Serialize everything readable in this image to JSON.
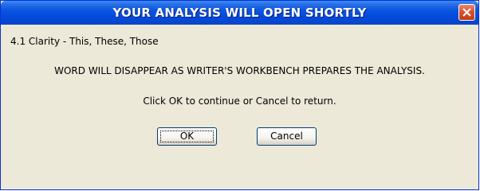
{
  "dialog": {
    "title": "YOUR ANALYSIS WILL OPEN SHORTLY",
    "close_icon": "close-icon",
    "subtitle": "4.1 Clarity - This, These, Those",
    "message": "WORD WILL DISAPPEAR AS WRITER'S WORKBENCH PREPARES THE ANALYSIS.",
    "instruction": "Click OK to continue or Cancel to return.",
    "ok_label": "OK",
    "cancel_label": "Cancel"
  },
  "colors": {
    "titlebar": "#0a55e0",
    "close_button": "#d7542f",
    "body": "#ece9d8",
    "border": "#0831d9"
  }
}
